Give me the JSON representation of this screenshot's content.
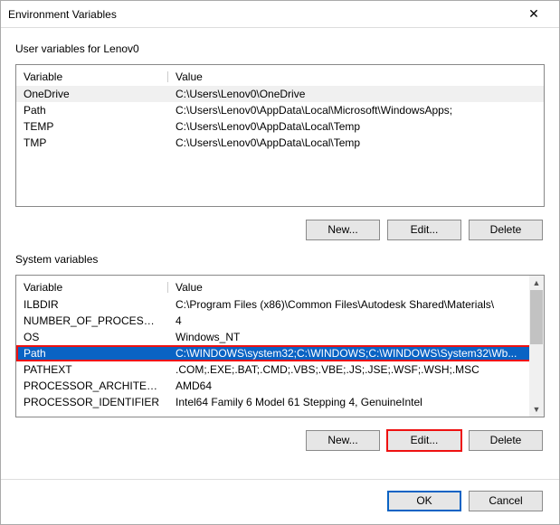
{
  "window": {
    "title": "Environment Variables"
  },
  "user_section": {
    "label": "User variables for Lenov0",
    "columns": {
      "var": "Variable",
      "val": "Value"
    },
    "rows": [
      {
        "var": "OneDrive",
        "val": "C:\\Users\\Lenov0\\OneDrive"
      },
      {
        "var": "Path",
        "val": "C:\\Users\\Lenov0\\AppData\\Local\\Microsoft\\WindowsApps;"
      },
      {
        "var": "TEMP",
        "val": "C:\\Users\\Lenov0\\AppData\\Local\\Temp"
      },
      {
        "var": "TMP",
        "val": "C:\\Users\\Lenov0\\AppData\\Local\\Temp"
      }
    ],
    "buttons": {
      "new": "New...",
      "edit": "Edit...",
      "delete": "Delete"
    }
  },
  "system_section": {
    "label": "System variables",
    "columns": {
      "var": "Variable",
      "val": "Value"
    },
    "rows": [
      {
        "var": "ILBDIR",
        "val": "C:\\Program Files (x86)\\Common Files\\Autodesk Shared\\Materials\\"
      },
      {
        "var": "NUMBER_OF_PROCESSORS",
        "val": "4"
      },
      {
        "var": "OS",
        "val": "Windows_NT"
      },
      {
        "var": "Path",
        "val": "C:\\WINDOWS\\system32;C:\\WINDOWS;C:\\WINDOWS\\System32\\Wb..."
      },
      {
        "var": "PATHEXT",
        "val": ".COM;.EXE;.BAT;.CMD;.VBS;.VBE;.JS;.JSE;.WSF;.WSH;.MSC"
      },
      {
        "var": "PROCESSOR_ARCHITECTURE",
        "val": "AMD64"
      },
      {
        "var": "PROCESSOR_IDENTIFIER",
        "val": "Intel64 Family 6 Model 61 Stepping 4, GenuineIntel"
      }
    ],
    "buttons": {
      "new": "New...",
      "edit": "Edit...",
      "delete": "Delete"
    }
  },
  "footer": {
    "ok": "OK",
    "cancel": "Cancel"
  }
}
